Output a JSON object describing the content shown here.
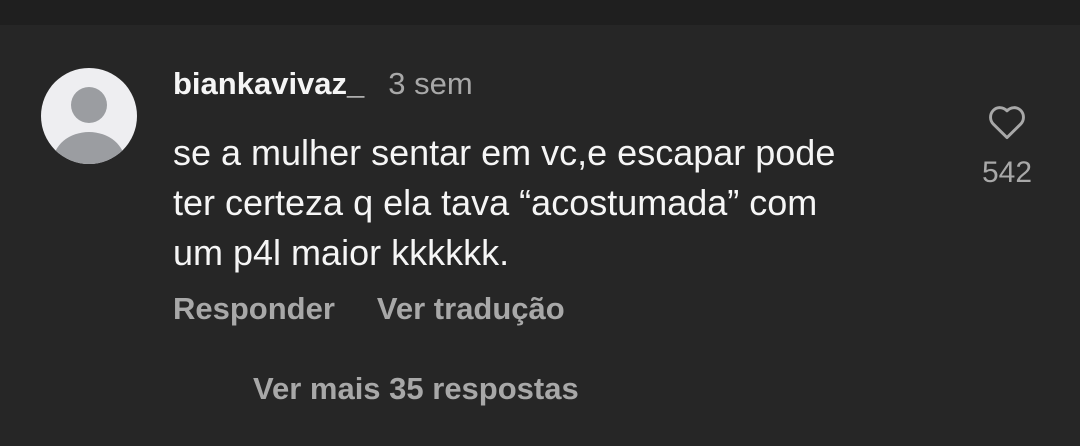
{
  "comment": {
    "avatar_icon": "default-avatar-icon",
    "username": "biankavivaz_",
    "timestamp": "3 sem",
    "text": "se a mulher sentar em vc,e escapar pode\nter certeza q ela tava “acostumada” com\num p4l maior kkkkkk.",
    "like_icon": "heart-outline-icon",
    "like_count": "542",
    "actions": {
      "reply_label": "Responder",
      "translate_label": "Ver tradução"
    },
    "more_replies_label": "Ver mais 35 respostas"
  },
  "colors": {
    "background": "#262626",
    "top_band": "#1f1f1f",
    "primary_text": "#f5f5f5",
    "secondary_text": "#a8a8a8",
    "avatar_bg": "#eeeef1",
    "avatar_figure": "#9b9da1"
  }
}
